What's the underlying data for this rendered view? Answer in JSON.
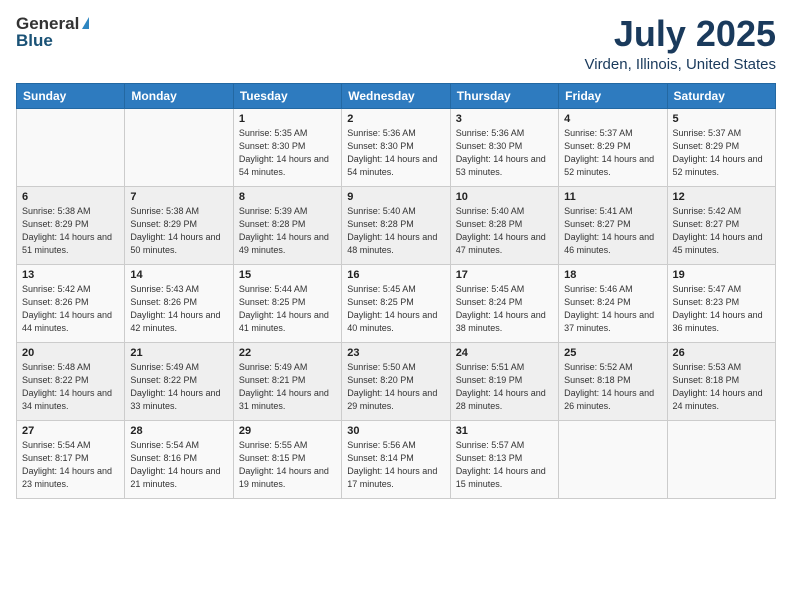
{
  "header": {
    "logo_general": "General",
    "logo_blue": "Blue",
    "title": "July 2025",
    "location": "Virden, Illinois, United States"
  },
  "days_of_week": [
    "Sunday",
    "Monday",
    "Tuesday",
    "Wednesday",
    "Thursday",
    "Friday",
    "Saturday"
  ],
  "weeks": [
    [
      {
        "day": "",
        "sunrise": "",
        "sunset": "",
        "daylight": ""
      },
      {
        "day": "",
        "sunrise": "",
        "sunset": "",
        "daylight": ""
      },
      {
        "day": "1",
        "sunrise": "Sunrise: 5:35 AM",
        "sunset": "Sunset: 8:30 PM",
        "daylight": "Daylight: 14 hours and 54 minutes."
      },
      {
        "day": "2",
        "sunrise": "Sunrise: 5:36 AM",
        "sunset": "Sunset: 8:30 PM",
        "daylight": "Daylight: 14 hours and 54 minutes."
      },
      {
        "day": "3",
        "sunrise": "Sunrise: 5:36 AM",
        "sunset": "Sunset: 8:30 PM",
        "daylight": "Daylight: 14 hours and 53 minutes."
      },
      {
        "day": "4",
        "sunrise": "Sunrise: 5:37 AM",
        "sunset": "Sunset: 8:29 PM",
        "daylight": "Daylight: 14 hours and 52 minutes."
      },
      {
        "day": "5",
        "sunrise": "Sunrise: 5:37 AM",
        "sunset": "Sunset: 8:29 PM",
        "daylight": "Daylight: 14 hours and 52 minutes."
      }
    ],
    [
      {
        "day": "6",
        "sunrise": "Sunrise: 5:38 AM",
        "sunset": "Sunset: 8:29 PM",
        "daylight": "Daylight: 14 hours and 51 minutes."
      },
      {
        "day": "7",
        "sunrise": "Sunrise: 5:38 AM",
        "sunset": "Sunset: 8:29 PM",
        "daylight": "Daylight: 14 hours and 50 minutes."
      },
      {
        "day": "8",
        "sunrise": "Sunrise: 5:39 AM",
        "sunset": "Sunset: 8:28 PM",
        "daylight": "Daylight: 14 hours and 49 minutes."
      },
      {
        "day": "9",
        "sunrise": "Sunrise: 5:40 AM",
        "sunset": "Sunset: 8:28 PM",
        "daylight": "Daylight: 14 hours and 48 minutes."
      },
      {
        "day": "10",
        "sunrise": "Sunrise: 5:40 AM",
        "sunset": "Sunset: 8:28 PM",
        "daylight": "Daylight: 14 hours and 47 minutes."
      },
      {
        "day": "11",
        "sunrise": "Sunrise: 5:41 AM",
        "sunset": "Sunset: 8:27 PM",
        "daylight": "Daylight: 14 hours and 46 minutes."
      },
      {
        "day": "12",
        "sunrise": "Sunrise: 5:42 AM",
        "sunset": "Sunset: 8:27 PM",
        "daylight": "Daylight: 14 hours and 45 minutes."
      }
    ],
    [
      {
        "day": "13",
        "sunrise": "Sunrise: 5:42 AM",
        "sunset": "Sunset: 8:26 PM",
        "daylight": "Daylight: 14 hours and 44 minutes."
      },
      {
        "day": "14",
        "sunrise": "Sunrise: 5:43 AM",
        "sunset": "Sunset: 8:26 PM",
        "daylight": "Daylight: 14 hours and 42 minutes."
      },
      {
        "day": "15",
        "sunrise": "Sunrise: 5:44 AM",
        "sunset": "Sunset: 8:25 PM",
        "daylight": "Daylight: 14 hours and 41 minutes."
      },
      {
        "day": "16",
        "sunrise": "Sunrise: 5:45 AM",
        "sunset": "Sunset: 8:25 PM",
        "daylight": "Daylight: 14 hours and 40 minutes."
      },
      {
        "day": "17",
        "sunrise": "Sunrise: 5:45 AM",
        "sunset": "Sunset: 8:24 PM",
        "daylight": "Daylight: 14 hours and 38 minutes."
      },
      {
        "day": "18",
        "sunrise": "Sunrise: 5:46 AM",
        "sunset": "Sunset: 8:24 PM",
        "daylight": "Daylight: 14 hours and 37 minutes."
      },
      {
        "day": "19",
        "sunrise": "Sunrise: 5:47 AM",
        "sunset": "Sunset: 8:23 PM",
        "daylight": "Daylight: 14 hours and 36 minutes."
      }
    ],
    [
      {
        "day": "20",
        "sunrise": "Sunrise: 5:48 AM",
        "sunset": "Sunset: 8:22 PM",
        "daylight": "Daylight: 14 hours and 34 minutes."
      },
      {
        "day": "21",
        "sunrise": "Sunrise: 5:49 AM",
        "sunset": "Sunset: 8:22 PM",
        "daylight": "Daylight: 14 hours and 33 minutes."
      },
      {
        "day": "22",
        "sunrise": "Sunrise: 5:49 AM",
        "sunset": "Sunset: 8:21 PM",
        "daylight": "Daylight: 14 hours and 31 minutes."
      },
      {
        "day": "23",
        "sunrise": "Sunrise: 5:50 AM",
        "sunset": "Sunset: 8:20 PM",
        "daylight": "Daylight: 14 hours and 29 minutes."
      },
      {
        "day": "24",
        "sunrise": "Sunrise: 5:51 AM",
        "sunset": "Sunset: 8:19 PM",
        "daylight": "Daylight: 14 hours and 28 minutes."
      },
      {
        "day": "25",
        "sunrise": "Sunrise: 5:52 AM",
        "sunset": "Sunset: 8:18 PM",
        "daylight": "Daylight: 14 hours and 26 minutes."
      },
      {
        "day": "26",
        "sunrise": "Sunrise: 5:53 AM",
        "sunset": "Sunset: 8:18 PM",
        "daylight": "Daylight: 14 hours and 24 minutes."
      }
    ],
    [
      {
        "day": "27",
        "sunrise": "Sunrise: 5:54 AM",
        "sunset": "Sunset: 8:17 PM",
        "daylight": "Daylight: 14 hours and 23 minutes."
      },
      {
        "day": "28",
        "sunrise": "Sunrise: 5:54 AM",
        "sunset": "Sunset: 8:16 PM",
        "daylight": "Daylight: 14 hours and 21 minutes."
      },
      {
        "day": "29",
        "sunrise": "Sunrise: 5:55 AM",
        "sunset": "Sunset: 8:15 PM",
        "daylight": "Daylight: 14 hours and 19 minutes."
      },
      {
        "day": "30",
        "sunrise": "Sunrise: 5:56 AM",
        "sunset": "Sunset: 8:14 PM",
        "daylight": "Daylight: 14 hours and 17 minutes."
      },
      {
        "day": "31",
        "sunrise": "Sunrise: 5:57 AM",
        "sunset": "Sunset: 8:13 PM",
        "daylight": "Daylight: 14 hours and 15 minutes."
      },
      {
        "day": "",
        "sunrise": "",
        "sunset": "",
        "daylight": ""
      },
      {
        "day": "",
        "sunrise": "",
        "sunset": "",
        "daylight": ""
      }
    ]
  ]
}
